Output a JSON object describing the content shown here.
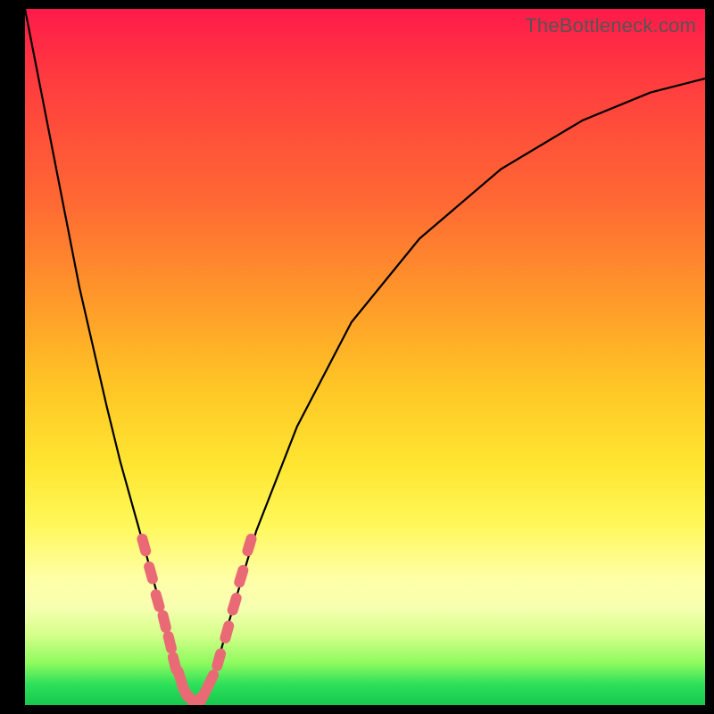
{
  "watermark": "TheBottleneck.com",
  "colors": {
    "red": "#ff1a4a",
    "orange": "#ff9a2a",
    "yellow": "#ffe733",
    "pale": "#ffffa8",
    "green": "#17c94e",
    "marker": "#e96a75",
    "frame": "#000000"
  },
  "chart_data": {
    "type": "line",
    "title": "",
    "xlabel": "",
    "ylabel": "",
    "xlim": [
      0,
      100
    ],
    "ylim": [
      0,
      100
    ],
    "annotations": [],
    "series": [
      {
        "name": "curve",
        "x": [
          0,
          4,
          8,
          12,
          14,
          16,
          18,
          20,
          21,
          22,
          23,
          24,
          25,
          26,
          28,
          30,
          34,
          40,
          48,
          58,
          70,
          82,
          92,
          100
        ],
        "values": [
          100,
          80,
          60,
          43,
          35,
          28,
          21,
          14,
          10,
          6,
          3,
          1,
          0,
          1,
          5,
          12,
          25,
          40,
          55,
          67,
          77,
          84,
          88,
          90
        ]
      }
    ],
    "markers": {
      "name": "highlighted-points",
      "color": "#e96a75",
      "x": [
        17.5,
        18.5,
        19.5,
        20.5,
        21.3,
        22.0,
        22.8,
        23.5,
        24.3,
        25.3,
        26.3,
        27.3,
        28.5,
        29.7,
        30.8,
        31.8,
        33.0
      ],
      "values": [
        23,
        19,
        15,
        12,
        9,
        6,
        4,
        2,
        1,
        0.5,
        1.5,
        3.5,
        6.5,
        10.5,
        14.5,
        18.5,
        23
      ]
    }
  }
}
